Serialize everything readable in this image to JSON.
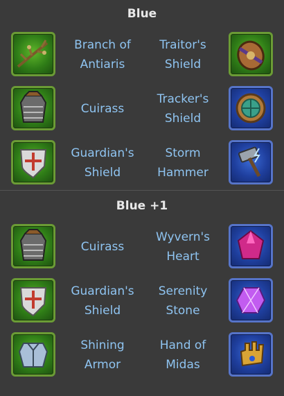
{
  "sections": [
    {
      "title": "Blue",
      "rows": [
        {
          "left": {
            "name": "Branch of Antiaris",
            "icon": "branch-icon",
            "frame": "green"
          },
          "right": {
            "name": "Traitor's Shield",
            "icon": "shield-icon",
            "frame": "green"
          }
        },
        {
          "left": {
            "name": "Cuirass",
            "icon": "cuirass-icon",
            "frame": "green"
          },
          "right": {
            "name": "Tracker's Shield",
            "icon": "round-shield-icon",
            "frame": "blue"
          }
        },
        {
          "left": {
            "name": "Guardian's Shield",
            "icon": "cross-shield-icon",
            "frame": "green"
          },
          "right": {
            "name": "Storm Hammer",
            "icon": "hammer-icon",
            "frame": "blue"
          }
        }
      ]
    },
    {
      "title": "Blue +1",
      "rows": [
        {
          "left": {
            "name": "Cuirass",
            "icon": "cuirass-icon",
            "frame": "green"
          },
          "right": {
            "name": "Wyvern's Heart",
            "icon": "gem-icon",
            "frame": "blue"
          }
        },
        {
          "left": {
            "name": "Guardian's Shield",
            "icon": "cross-shield-icon",
            "frame": "green"
          },
          "right": {
            "name": "Serenity Stone",
            "icon": "crystal-icon",
            "frame": "blue"
          }
        },
        {
          "left": {
            "name": "Shining Armor",
            "icon": "armor-icon",
            "frame": "green"
          },
          "right": {
            "name": "Hand of Midas",
            "icon": "gauntlet-icon",
            "frame": "blue"
          }
        }
      ]
    }
  ]
}
